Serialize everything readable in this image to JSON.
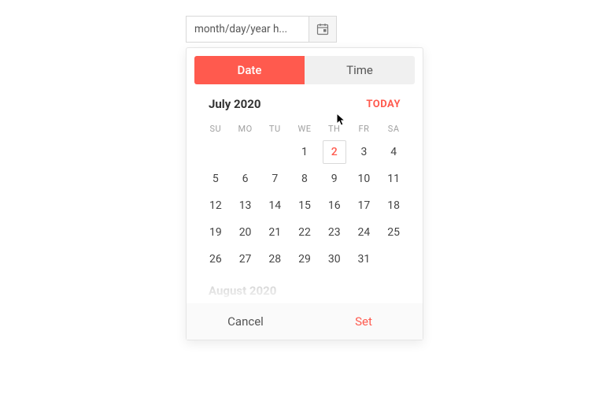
{
  "input": {
    "placeholder": "month/day/year h..."
  },
  "tabs": {
    "date": "Date",
    "time": "Time"
  },
  "calendar": {
    "month_label": "July 2020",
    "today_label": "TODAY",
    "dow": {
      "su": "SU",
      "mo": "MO",
      "tu": "TU",
      "we": "WE",
      "th": "TH",
      "fr": "FR",
      "sa": "SA"
    },
    "weeks": [
      {
        "d0": "",
        "d1": "",
        "d2": "",
        "d3": "1",
        "d4": "2",
        "d5": "3",
        "d6": "4"
      },
      {
        "d0": "5",
        "d1": "6",
        "d2": "7",
        "d3": "8",
        "d4": "9",
        "d5": "10",
        "d6": "11"
      },
      {
        "d0": "12",
        "d1": "13",
        "d2": "14",
        "d3": "15",
        "d4": "16",
        "d5": "17",
        "d6": "18"
      },
      {
        "d0": "19",
        "d1": "20",
        "d2": "21",
        "d3": "22",
        "d4": "23",
        "d5": "24",
        "d6": "25"
      },
      {
        "d0": "26",
        "d1": "27",
        "d2": "28",
        "d3": "29",
        "d4": "30",
        "d5": "31",
        "d6": ""
      }
    ],
    "today_day": "2",
    "next_month_label": "August 2020"
  },
  "actions": {
    "cancel": "Cancel",
    "set": "Set"
  },
  "colors": {
    "accent": "#ff5a4e"
  }
}
